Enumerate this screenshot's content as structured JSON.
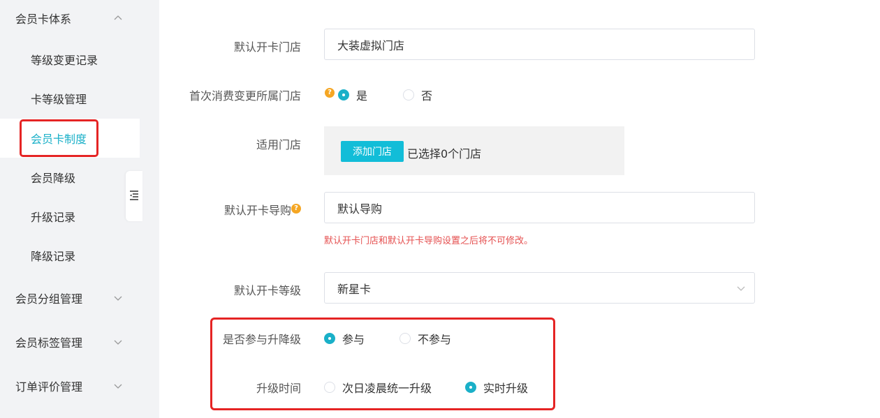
{
  "sidebar": {
    "group_member_card": "会员卡体系",
    "items": [
      {
        "label": "等级变更记录"
      },
      {
        "label": "卡等级管理"
      },
      {
        "label": "会员卡制度"
      },
      {
        "label": "会员降级"
      },
      {
        "label": "升级记录"
      },
      {
        "label": "降级记录"
      }
    ],
    "groups": [
      {
        "label": "会员分组管理"
      },
      {
        "label": "会员标签管理"
      },
      {
        "label": "订单评价管理"
      }
    ]
  },
  "form": {
    "default_store": {
      "label": "默认开卡门店",
      "value": "大装虚拟门店"
    },
    "first_purchase": {
      "label": "首次消费变更所属门店",
      "yes": "是",
      "no": "否",
      "selected": "yes"
    },
    "applicable_store": {
      "label": "适用门店",
      "add_button": "添加门店",
      "count_text": "已选择0个门店"
    },
    "default_guide": {
      "label": "默认开卡导购",
      "value": "默认导购"
    },
    "warning": "默认开卡门店和默认开卡导购设置之后将不可修改。",
    "default_level": {
      "label": "默认开卡等级",
      "value": "新星卡"
    },
    "participate": {
      "label": "是否参与升降级",
      "yes": "参与",
      "no": "不参与",
      "selected": "yes"
    },
    "upgrade_time": {
      "label": "升级时间",
      "next_day": "次日凌晨统一升级",
      "realtime": "实时升级",
      "selected": "realtime"
    }
  },
  "colors": {
    "accent": "#1ab0c8",
    "highlight": "#e52424",
    "warning": "#e55050",
    "help": "#f5a623"
  }
}
